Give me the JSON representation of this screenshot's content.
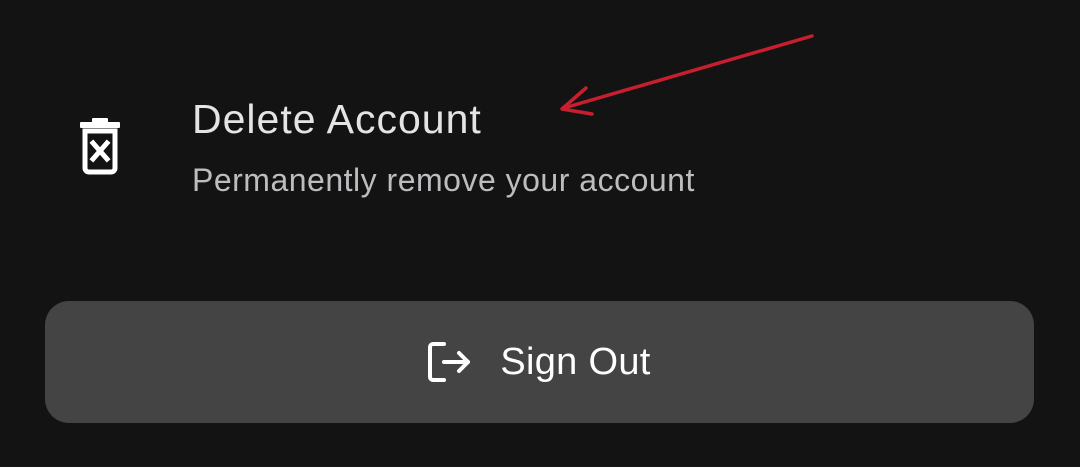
{
  "delete_account": {
    "title": "Delete Account",
    "subtitle": "Permanently remove your account",
    "icon": "trash-x-icon"
  },
  "sign_out": {
    "label": "Sign Out",
    "icon": "logout-icon"
  },
  "colors": {
    "background": "#131314",
    "button_bg": "#444445",
    "annotation_arrow": "#c81e2e",
    "title_text": "#e4e4e6",
    "subtitle_text": "#bdbdbf"
  }
}
